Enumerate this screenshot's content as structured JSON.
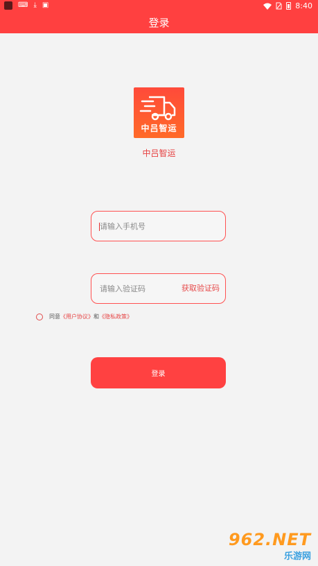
{
  "status_bar": {
    "time": "8:40",
    "left_icons": [
      "app-icon",
      "keyboard-icon",
      "download-icon",
      "a-icon"
    ],
    "right_icons": [
      "wifi-icon",
      "no-sim-icon",
      "battery-icon"
    ]
  },
  "header": {
    "title": "登录"
  },
  "logo": {
    "text": "中吕智运"
  },
  "app_name": "中吕智运",
  "phone_field": {
    "placeholder": "请输入手机号",
    "value": ""
  },
  "code_field": {
    "placeholder": "请输入验证码",
    "value": "",
    "get_code_label": "获取验证码"
  },
  "agreement": {
    "prefix": "同意",
    "user_agreement": "《用户协议》",
    "conjunction": "和",
    "privacy_policy": "《隐私政策》",
    "checked": false
  },
  "login_button": {
    "label": "登录"
  },
  "watermark": {
    "number": "962.NET",
    "text": "乐游网"
  },
  "colors": {
    "brand_red": "#ff4040",
    "link_red": "#e64545",
    "background": "#f3f3f3"
  }
}
